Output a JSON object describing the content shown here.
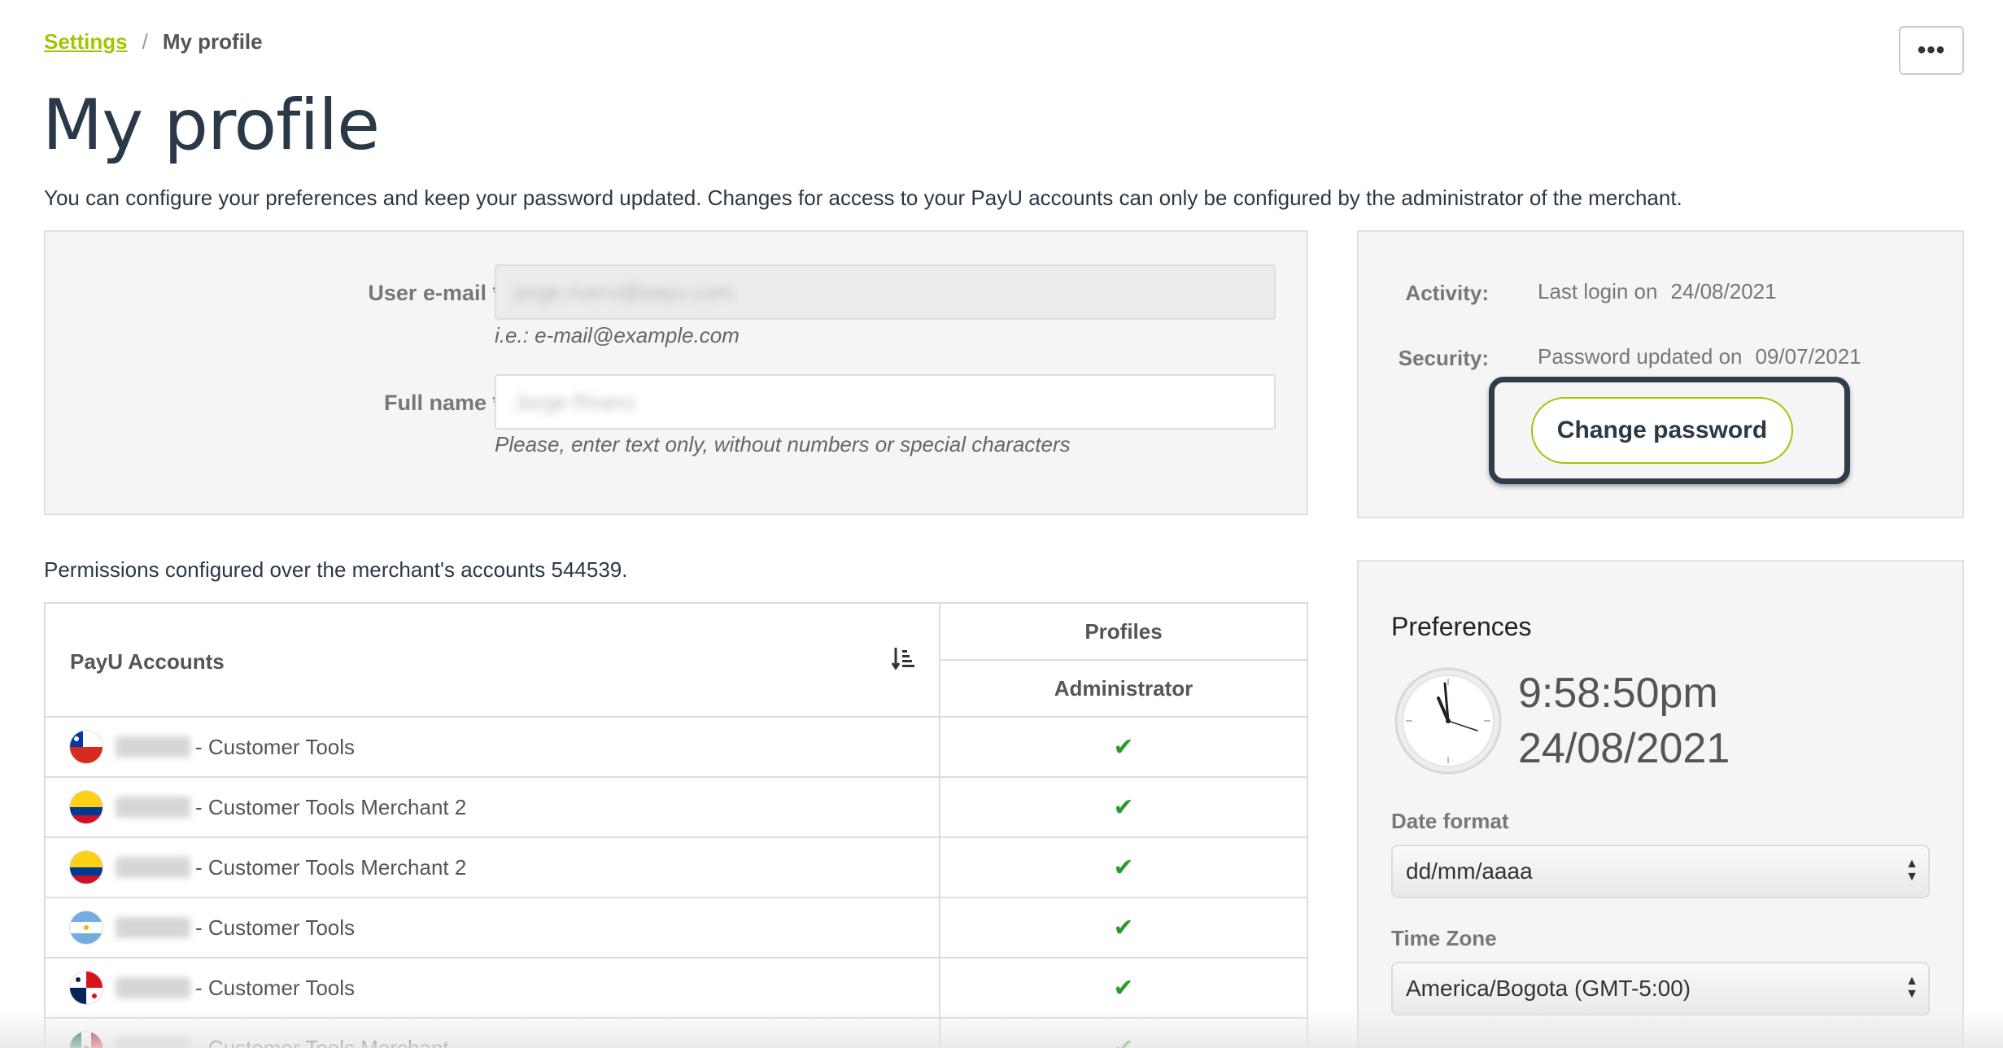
{
  "breadcrumb": {
    "parent": "Settings",
    "separator": "/",
    "current": "My profile"
  },
  "more_button": {
    "label": "•••"
  },
  "page_title": "My profile",
  "intro": "You can configure your preferences and keep your password updated. Changes for access to your PayU accounts can only be configured by the administrator of the merchant.",
  "form": {
    "email_label": "User e-mail *",
    "email_value": "jorge.rivero@payu.com",
    "email_help": "i.e.: e-mail@example.com",
    "name_label": "Full name *",
    "name_value": "Jorge Rivero",
    "name_help": "Please, enter text only, without numbers or special characters"
  },
  "activity": {
    "activity_label": "Activity:",
    "activity_text": "Last login on",
    "activity_date": "24/08/2021",
    "security_label": "Security:",
    "security_text": "Password updated on",
    "security_date": "09/07/2021",
    "change_password_label": "Change password"
  },
  "permissions": {
    "text": "Permissions configured over the merchant's accounts 544539.",
    "col_accounts": "PayU Accounts",
    "col_profiles": "Profiles",
    "col_role": "Administrator",
    "rows": [
      {
        "name": "- Customer Tools",
        "flag": "chile",
        "checked": "✔"
      },
      {
        "name": "- Customer Tools Merchant 2",
        "flag": "colombia",
        "checked": "✔"
      },
      {
        "name": "- Customer Tools Merchant 2",
        "flag": "colombia",
        "checked": "✔"
      },
      {
        "name": "- Customer Tools",
        "flag": "argentina",
        "checked": "✔"
      },
      {
        "name": "- Customer Tools",
        "flag": "panama",
        "checked": "✔"
      },
      {
        "name": "- Customer Tools Merchant",
        "flag": "mexico",
        "checked": "✔"
      }
    ]
  },
  "preferences": {
    "title": "Preferences",
    "time": "9:58:50pm",
    "date": "24/08/2021",
    "date_format_label": "Date format",
    "date_format_value": "dd/mm/aaaa",
    "time_zone_label": "Time Zone",
    "time_zone_value": "America/Bogota (GMT-5:00)"
  },
  "colors": {
    "accent": "#a6c307",
    "title": "#2a3947",
    "check": "#2e9a2e"
  }
}
